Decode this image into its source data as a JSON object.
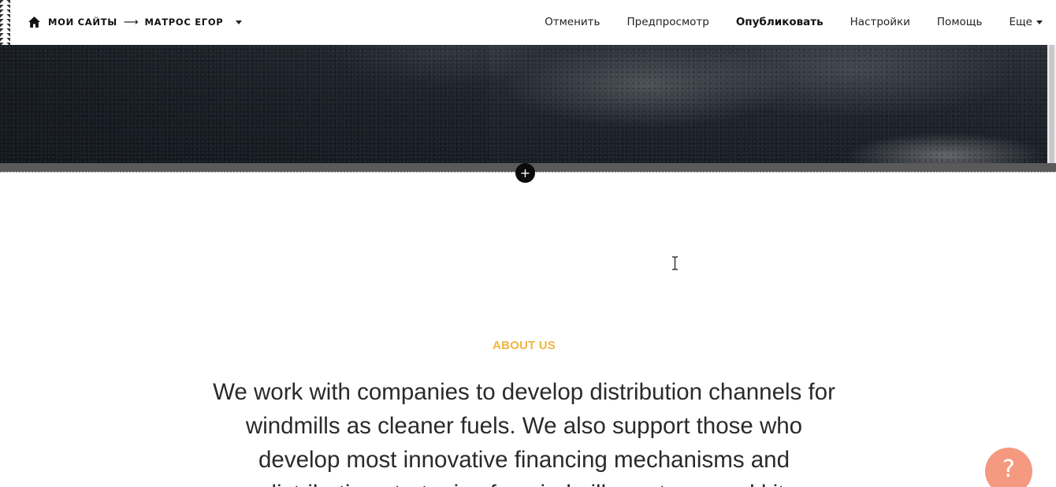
{
  "breadcrumb": {
    "home_icon": "home-icon",
    "items": [
      "МОИ САЙТЫ",
      "МАТРОС ЕГОР"
    ],
    "separator": "⟶"
  },
  "menu": {
    "items": [
      "Отменить",
      "Предпросмотр",
      "Опубликовать",
      "Настройки",
      "Помощь"
    ],
    "more_label": "Еще"
  },
  "hero": {
    "image": "dark mountain valley landscape photo"
  },
  "add_section": {
    "label": "+"
  },
  "about": {
    "label": "ABOUT US",
    "text": "We work with companies to develop distribution channels for windmills as cleaner fuels. We also support those who develop most innovative financing mechanisms and distribution strategies for windmills systems and kit"
  },
  "help": {
    "label": "?"
  },
  "colors": {
    "accent": "#f0b541",
    "help_bubble": "#f59a80",
    "divider": "#5a5a5a"
  }
}
